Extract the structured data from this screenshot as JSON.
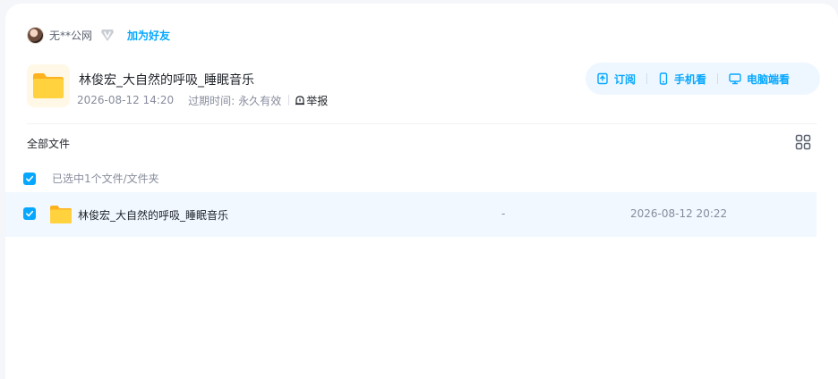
{
  "user": {
    "name": "无**公网",
    "add_friend": "加为好友"
  },
  "share": {
    "title": "林俊宏_大自然的呼吸_睡眠音乐",
    "date": "2026-08-12 14:20",
    "expire_label": "过期时间:",
    "expire_value": "永久有效",
    "report": "举报"
  },
  "actions": {
    "subscribe": "订阅",
    "mobile": "手机看",
    "desktop": "电脑端看"
  },
  "breadcrumb": "全部文件",
  "selection_text": "已选中1个文件/文件夹",
  "files": [
    {
      "name": "林俊宏_大自然的呼吸_睡眠音乐",
      "size": "-",
      "modified": "2026-08-12 20:22",
      "checked": true
    }
  ],
  "colors": {
    "accent": "#06a7ff",
    "selected_row": "#f1f8ff",
    "folder": "#ffc53d"
  },
  "icons": {
    "vip": "diamond-icon",
    "subscribe": "subscribe-icon",
    "mobile": "phone-icon",
    "desktop": "monitor-icon",
    "report": "report-icon",
    "view": "grid-view-icon"
  }
}
